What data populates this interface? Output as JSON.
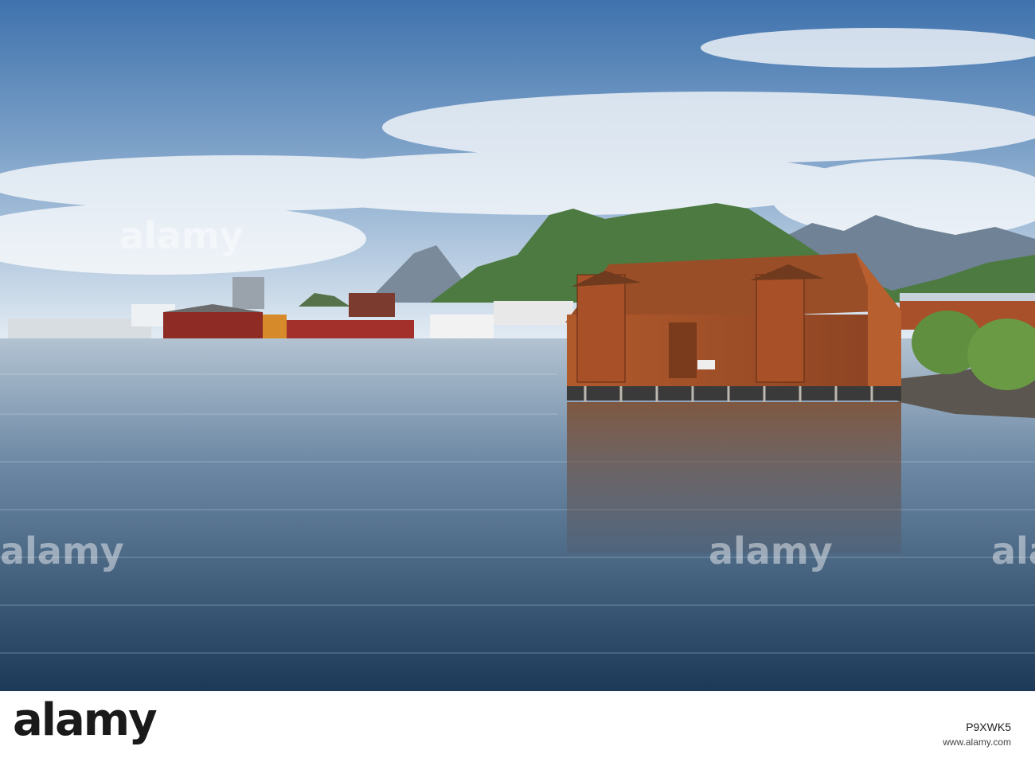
{
  "watermark": {
    "text": "alamy"
  },
  "footer": {
    "logo": "alamy",
    "image_id": "P9XWK5",
    "url": "www.alamy.com"
  },
  "scene": {
    "sign_text": "",
    "colors": {
      "sky_top": "#4f7fb8",
      "sky_bottom": "#dfe8f2",
      "water_top": "#a9bccf",
      "water_bottom": "#1f3f5e",
      "warehouse": "#a9552b",
      "roof": "#9a4e27",
      "mountain": "#4e7a43"
    }
  }
}
